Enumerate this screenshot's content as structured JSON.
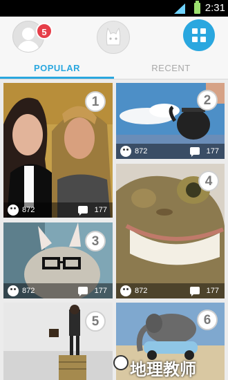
{
  "status_bar": {
    "time": "2:31"
  },
  "header": {
    "notification_count": "5"
  },
  "tabs": [
    {
      "label": "POPULAR",
      "active": true
    },
    {
      "label": "RECENT",
      "active": false
    }
  ],
  "cards": [
    {
      "rank": "1",
      "likes": "872",
      "comments": "177"
    },
    {
      "rank": "2",
      "likes": "872",
      "comments": "177"
    },
    {
      "rank": "3",
      "likes": "872",
      "comments": "177"
    },
    {
      "rank": "4",
      "likes": "872",
      "comments": "177"
    },
    {
      "rank": "5"
    },
    {
      "rank": "6"
    }
  ],
  "watermark": {
    "text": "地理教师"
  },
  "colors": {
    "accent": "#2aa7df",
    "badge": "#e63e49"
  }
}
